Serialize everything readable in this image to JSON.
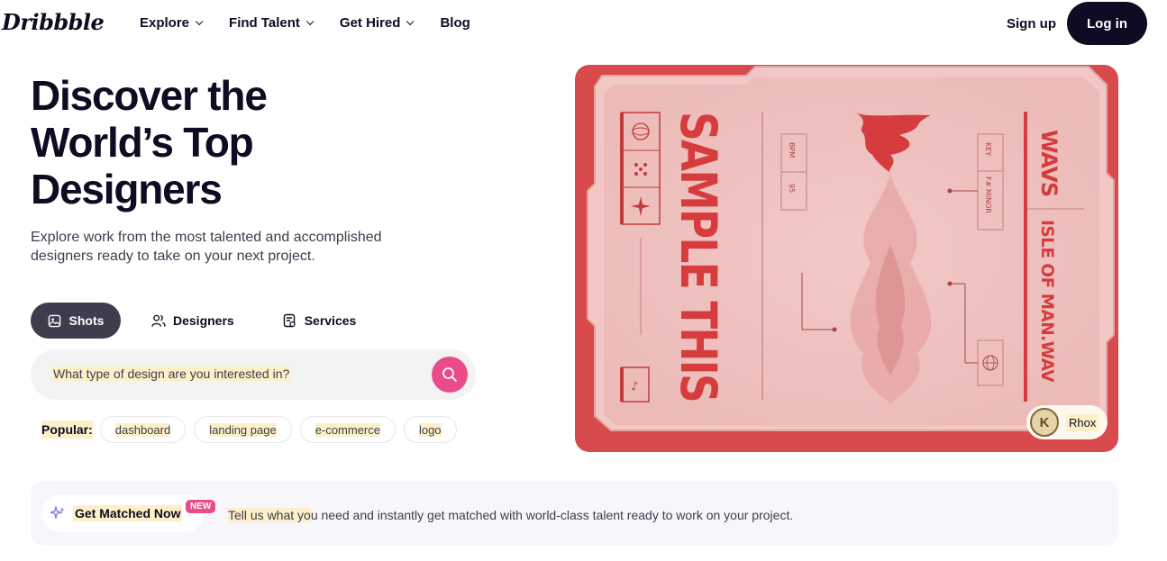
{
  "header": {
    "logo": "Dribbble",
    "nav": [
      {
        "label": "Explore",
        "dropdown": true
      },
      {
        "label": "Find Talent",
        "dropdown": true
      },
      {
        "label": "Get Hired",
        "dropdown": true
      },
      {
        "label": "Blog",
        "dropdown": false
      }
    ],
    "signup": "Sign up",
    "login": "Log in"
  },
  "hero": {
    "title_line1": "Discover the",
    "title_line2": "World’s Top",
    "title_line3": "Designers",
    "subtitle": "Explore work from the most talented and accomplished designers ready to take on your next project.",
    "tabs": [
      {
        "label": "Shots",
        "icon": "image-icon",
        "active": true
      },
      {
        "label": "Designers",
        "icon": "people-icon",
        "active": false
      },
      {
        "label": "Services",
        "icon": "services-icon",
        "active": false
      }
    ],
    "search": {
      "placeholder": "What type of design are you interested in?"
    },
    "popular": {
      "label": "Popular:",
      "tags": [
        "dashboard",
        "landing page",
        "e-commerce",
        "logo"
      ]
    },
    "shot": {
      "headline": "SAMPLE THIS",
      "bpm_label": "BPM",
      "bpm_value": "95",
      "key_label": "KEY",
      "key_value": "F# MINOR",
      "brand": "WAVS",
      "track": "ISLE OF MAN.WAV",
      "credit": "Rhox"
    }
  },
  "banner": {
    "cta": "Get Matched Now",
    "badge": "NEW",
    "text_highlight": "Tell us what yo",
    "text_rest": "u need and instantly get matched with world-class talent ready to work on your project."
  },
  "colors": {
    "brand_dark": "#0d0c22",
    "accent_pink": "#ea4c89",
    "shot_red": "#d84a4b"
  }
}
